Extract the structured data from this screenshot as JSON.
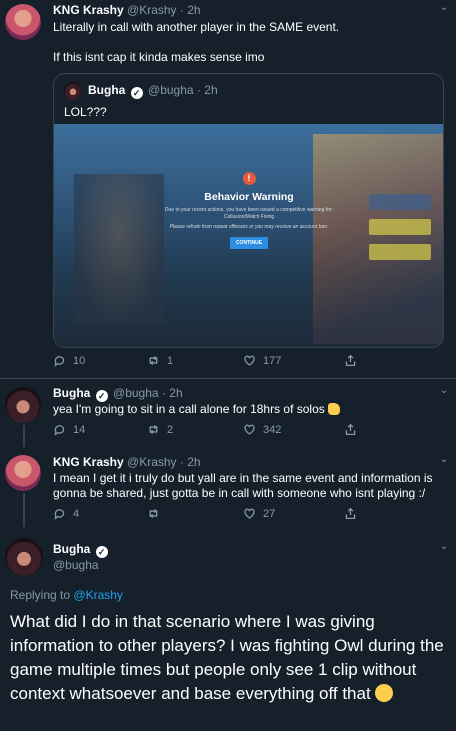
{
  "tweet1": {
    "name": "KNG Krashy",
    "handle": "@Krashy",
    "time": "2h",
    "line1": "Literally in call with another player in the SAME event.",
    "line2": "If this isnt cap it kinda makes sense imo",
    "quote": {
      "name": "Bugha",
      "handle": "@bugha",
      "time": "2h",
      "text": "LOL???",
      "image": {
        "warn_glyph": "!",
        "title": "Behavior Warning",
        "body": "Due to your recent actions, you have been issued a competitive warning for: Collusion/Match Fixing",
        "body2": "Please refrain from repeat offenses or you may receive an account ban.",
        "button": "CONTINUE"
      }
    },
    "replies": "10",
    "retweets": "1",
    "likes": "177"
  },
  "tweet2": {
    "name": "Bugha",
    "handle": "@bugha",
    "time": "2h",
    "text": "yea I'm going to sit in a call alone for 18hrs of solos",
    "emoji": "thumbs-up",
    "replies": "14",
    "retweets": "2",
    "likes": "342"
  },
  "tweet3": {
    "name": "KNG Krashy",
    "handle": "@Krashy",
    "time": "2h",
    "text": "I mean I get it i truly do but yall are in the same event and information is gonna be shared, just gotta be in call with someone who isnt playing :/",
    "replies": "4",
    "retweets": "",
    "likes": "27"
  },
  "main": {
    "name": "Bugha",
    "handle": "@bugha",
    "replying_prefix": "Replying to",
    "replying_to": "@Krashy",
    "text": "What did I do in that scenario where I was giving information to other players? I was fighting Owl during the game multiple times but people only see 1 clip without context whatsoever and base everything off that",
    "emoji": "grinning-face"
  },
  "meta": {
    "dot": "·",
    "verified_glyph": "✓",
    "caret_glyph": "⌄"
  },
  "colors": {
    "background": "#15202b",
    "secondary": "#8899a6",
    "accent": "#1da1f2",
    "border": "#38444d"
  }
}
